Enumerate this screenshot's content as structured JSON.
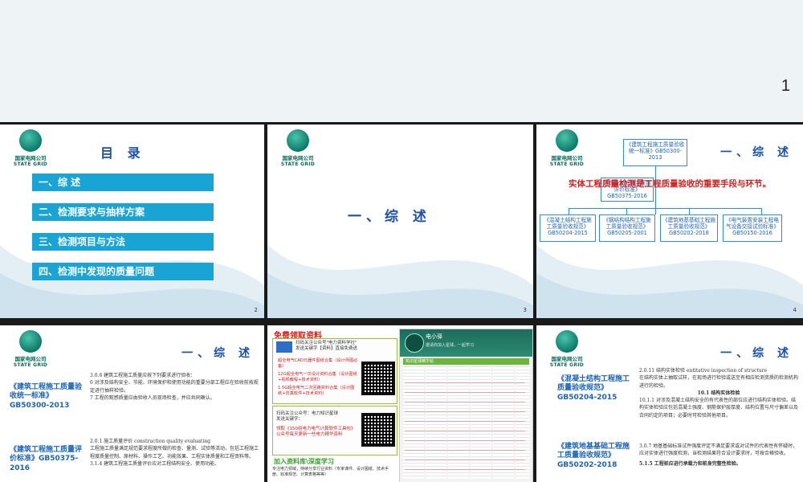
{
  "hero": {
    "page_number": "1"
  },
  "logo": {
    "cn": "国家电网公司",
    "en": "STATE GRID"
  },
  "slide2": {
    "title": "目 录",
    "items": [
      "一、综 述",
      "二、检测要求与抽样方案",
      "三、检测项目与方法",
      "四、检测中发现的质量问题"
    ],
    "page": "2"
  },
  "slide3": {
    "title": "一、综 述",
    "page": "3"
  },
  "slide4": {
    "title": "一、综 述",
    "top_box": "《建筑工程施工质量验收统一标准》GB50300-2013",
    "mid_box": "《建筑工程施工质量评价标准》GB50375-2016",
    "red_text": "实体工程质量检测是工程质量验收的重要手段与环节。",
    "bottom_boxes": [
      "《混凝土结构工程施工质量验收规范》GB50204-2015",
      "《钢结构结构工程施工质量验收规范》GB50205-2001",
      "《建筑地基基础工程施工质量验收规范》GB50202-2018",
      "《电气装置安装工程电气设备交接试验标准》GB50150-2016"
    ],
    "page": "4"
  },
  "slide5": {
    "title": "一、综 述",
    "std1": "《建筑工程施工质量验收统一标准》GB50300-2013",
    "std2": "《建筑工程施工质量评价标准》GB50375-2016",
    "doc_lines": [
      "3.0.6 建筑工程施工质量应按下列要求进行验收：",
      "6 对涉及结构安全、节能、环境保护和使用功能的重要分部工程应在验收前按规定进行抽样检验。",
      "7 工程的观感质量应由验收人员现场检查，并应共同确认。",
      "2.0.1 施工质量评价 construction quality evaluating",
      "工程施工质量满足规范要求程度所做的检查、量测、试验等活动，包括工程施工程度质量控制、原材料、操作工艺、功能效果、工程实体质量和工程资料等。",
      "3.1.4 建筑工程施工质量评价应对工程结构安全、使用功能、"
    ]
  },
  "slide6": {
    "ad_title": "免费领取资料",
    "box1_lines": [
      "扫码关注公众号\"电力资料学社\"",
      "发送关键字【资料】直接免费送"
    ],
    "gifts": [
      "超全电气CAD元器件图纸合集（设计师图必备）",
      "12G超全电气一次设计资料合集（设计图纸+视频教程+技术资料）",
      "1.5G超全电气二次回路资料合集（设计图纸+仿真软件+技术资料）"
    ],
    "box2_lines": [
      "扫码关注公众号：电力知识星球",
      "发送关键字：",
      "领取《150组电力电气计算软件工具包》",
      "公众号每天更新一些电力精华资料"
    ],
    "join_title": "加入资料库\\深度学习",
    "join_text": "专注电力领域，持续分享行业资料（专家课件、设计图纸、技术手册、标准规范、计算表格等等）",
    "phone_name": "电小驿",
    "phone_sub": "邀请你加入星球，一起学习",
    "phone_bar": "知识星球精华帖"
  },
  "slide7": {
    "title": "一、综 述",
    "std1": "《混凝土结构工程施工质量验收规范》GB50204-2015",
    "std2": "《建筑地基基础工程施工质量验收规范》GB50202-2018",
    "doc_lines": [
      "2.0.11 结构实体检验 entitative inspection of structure",
      "在结构实体上抽取试样，在现场进行检验或送至有相应检测资质的检测机构进行的检验。",
      "10.1 结构实体检验",
      "10.1.1 对涉及混凝土结构安全的有代表性的部位应进行结构实体检验。结构实体检验应包括混凝土强度、钢筋保护层厚度、结构位置与尺寸偏差以及合同约定的项目；必要时可检验其他项目。",
      "3.0.7 地基基础标准试件强度评定不满足要求或对试件的代表性有怀疑时，应对实体进行强度检测，当检测结果符合设计要求时，可按合格验收。",
      "5.1.5 工程桩应进行承载力和桩身完整性检验。"
    ]
  }
}
